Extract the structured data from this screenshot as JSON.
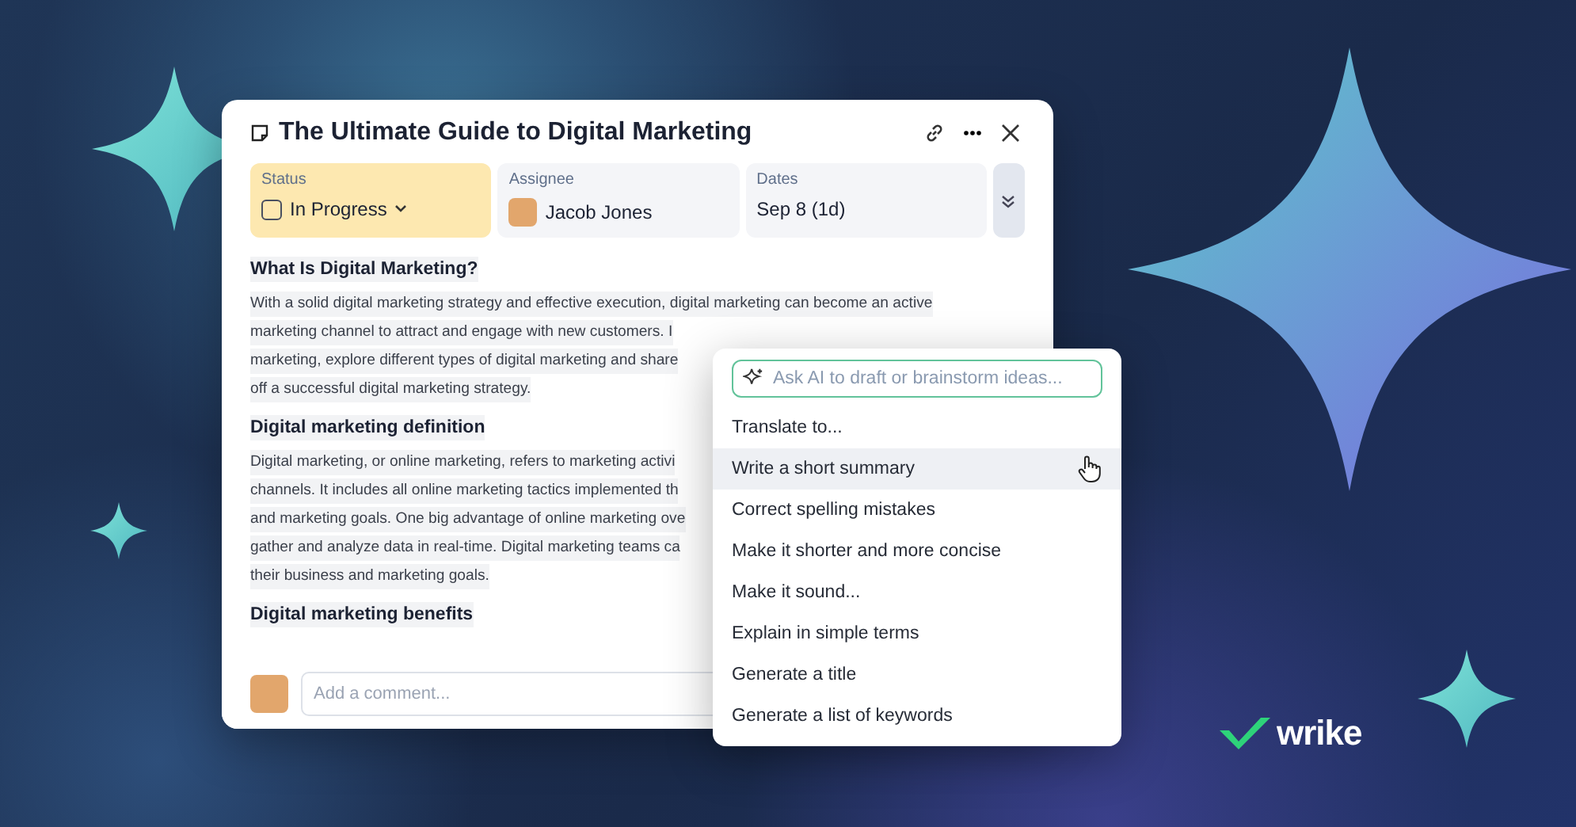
{
  "task": {
    "title": "The Ultimate Guide to Digital Marketing",
    "fields": [
      {
        "kind": "status",
        "label": "Status",
        "value": "In Progress",
        "checked": false
      },
      {
        "kind": "assignee",
        "label": "Assignee",
        "value": "Jacob Jones"
      },
      {
        "kind": "dates",
        "label": "Dates",
        "value": "Sep 8 (1d)"
      }
    ],
    "sections": [
      {
        "heading": "What Is Digital Marketing?",
        "lines": [
          "With a solid digital marketing strategy and effective execution, digital marketing can become an active",
          "marketing channel to attract and engage with new customers. I",
          "marketing, explore different types of digital marketing and share",
          "off a successful digital marketing strategy."
        ]
      },
      {
        "heading": "Digital marketing definition",
        "lines": [
          "Digital marketing, or online marketing, refers to marketing activi",
          "channels. It includes all online marketing tactics implemented th",
          "and marketing goals. One big advantage of online marketing ove",
          "gather and analyze data in real-time. Digital marketing teams ca",
          "their business and marketing goals."
        ]
      },
      {
        "heading": "Digital marketing benefits"
      }
    ],
    "comment": {
      "placeholder": "Add a comment..."
    }
  },
  "ai_menu": {
    "placeholder": "Ask AI to draft or brainstorm ideas...",
    "items": [
      {
        "label": "Translate to...",
        "selected": false
      },
      {
        "label": "Write a short summary",
        "selected": true
      },
      {
        "label": "Correct spelling mistakes",
        "selected": false
      },
      {
        "label": "Make it shorter and more concise",
        "selected": false
      },
      {
        "label": "Make it sound...",
        "selected": false
      },
      {
        "label": "Explain in simple terms",
        "selected": false
      },
      {
        "label": "Generate a title",
        "selected": false
      },
      {
        "label": "Generate a list of keywords",
        "selected": false
      }
    ]
  },
  "logo": {
    "text": "wrike"
  }
}
